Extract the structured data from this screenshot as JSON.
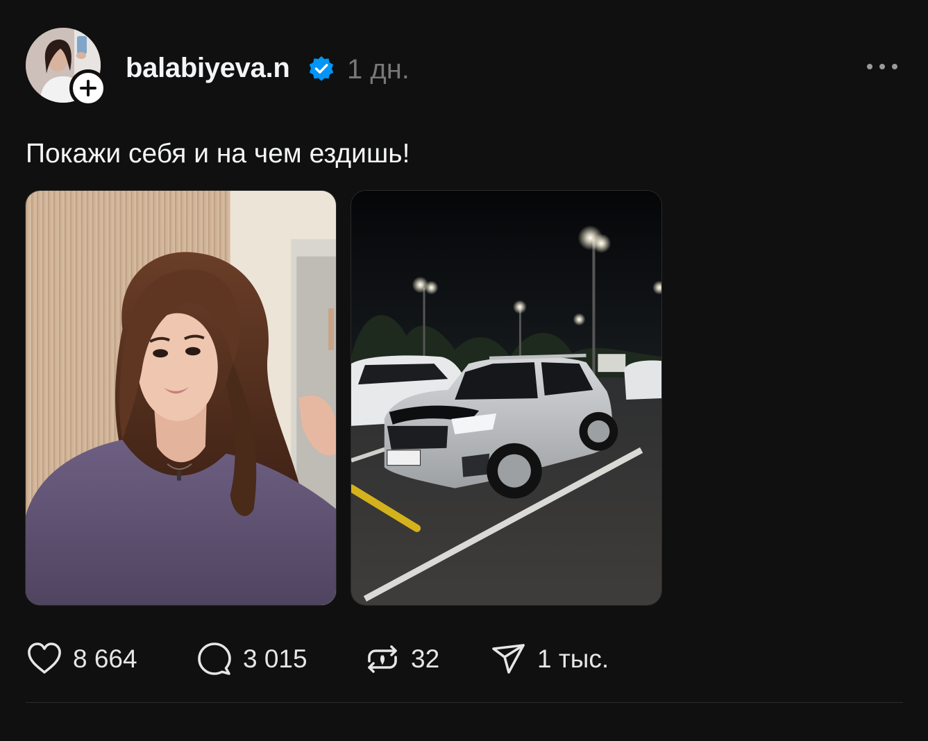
{
  "post": {
    "author": {
      "username": "balabiyeva.n",
      "verified": true,
      "avatar_icon": "profile-avatar",
      "follow_icon": "plus-icon"
    },
    "timestamp": "1 дн.",
    "more_icon": "more-horizontal-icon",
    "caption": "Покажи себя и на чем ездишь!",
    "media": [
      {
        "type": "photo",
        "subject": "portrait"
      },
      {
        "type": "photo",
        "subject": "car"
      }
    ],
    "actions": {
      "like": {
        "icon": "heart-icon",
        "count": "8 664"
      },
      "comment": {
        "icon": "comment-bubble-icon",
        "count": "3 015"
      },
      "repost": {
        "icon": "repost-icon",
        "count": "32"
      },
      "share": {
        "icon": "send-icon",
        "count": "1 тыс."
      }
    }
  },
  "colors": {
    "background": "#101010",
    "text_primary": "#f3f5f7",
    "text_secondary": "#777777",
    "verified_blue": "#0095f6",
    "divider": "#2c2c2c"
  }
}
